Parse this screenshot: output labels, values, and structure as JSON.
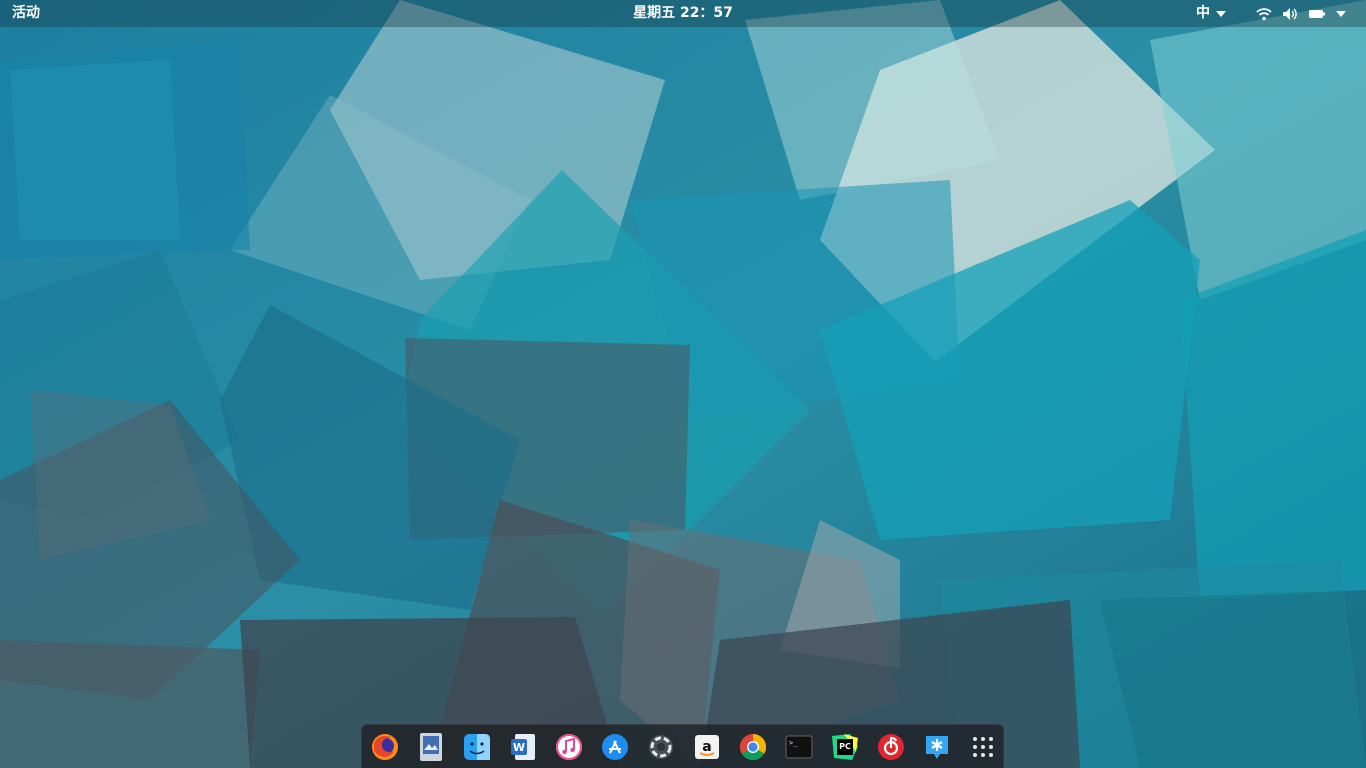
{
  "topbar": {
    "activities_label": "活动",
    "clock": "星期五 22：57",
    "input_method": "中"
  },
  "tray": {
    "icons": [
      "wifi-icon",
      "volume-icon",
      "battery-icon",
      "system-menu-arrow-icon"
    ]
  },
  "dock": {
    "apps": [
      {
        "name": "firefox",
        "icon": "firefox-icon"
      },
      {
        "name": "image-viewer",
        "icon": "image-viewer-icon"
      },
      {
        "name": "finder",
        "icon": "finder-icon"
      },
      {
        "name": "word",
        "icon": "word-icon"
      },
      {
        "name": "itunes",
        "icon": "itunes-icon"
      },
      {
        "name": "app-store",
        "icon": "app-store-icon"
      },
      {
        "name": "settings",
        "icon": "settings-ring-icon"
      },
      {
        "name": "amazon",
        "icon": "amazon-icon"
      },
      {
        "name": "chrome",
        "icon": "chrome-icon"
      },
      {
        "name": "terminal",
        "icon": "terminal-icon"
      },
      {
        "name": "pycharm",
        "icon": "pycharm-icon"
      },
      {
        "name": "netease-music",
        "icon": "netease-music-icon"
      },
      {
        "name": "app-center",
        "icon": "app-center-icon"
      },
      {
        "name": "show-applications",
        "icon": "grid-icon"
      }
    ],
    "labels": {
      "word": "W",
      "pycharm": "PC",
      "amazon": "a",
      "terminal": ">_"
    }
  },
  "colors": {
    "wallpaper_base": "#1f7f99",
    "wallpaper_teal": "#13a1b5",
    "wallpaper_light": "#d9e4e1",
    "wallpaper_dark": "#3d4650",
    "topbar_text": "#ffffff",
    "dock_bg": "#1e2226"
  }
}
